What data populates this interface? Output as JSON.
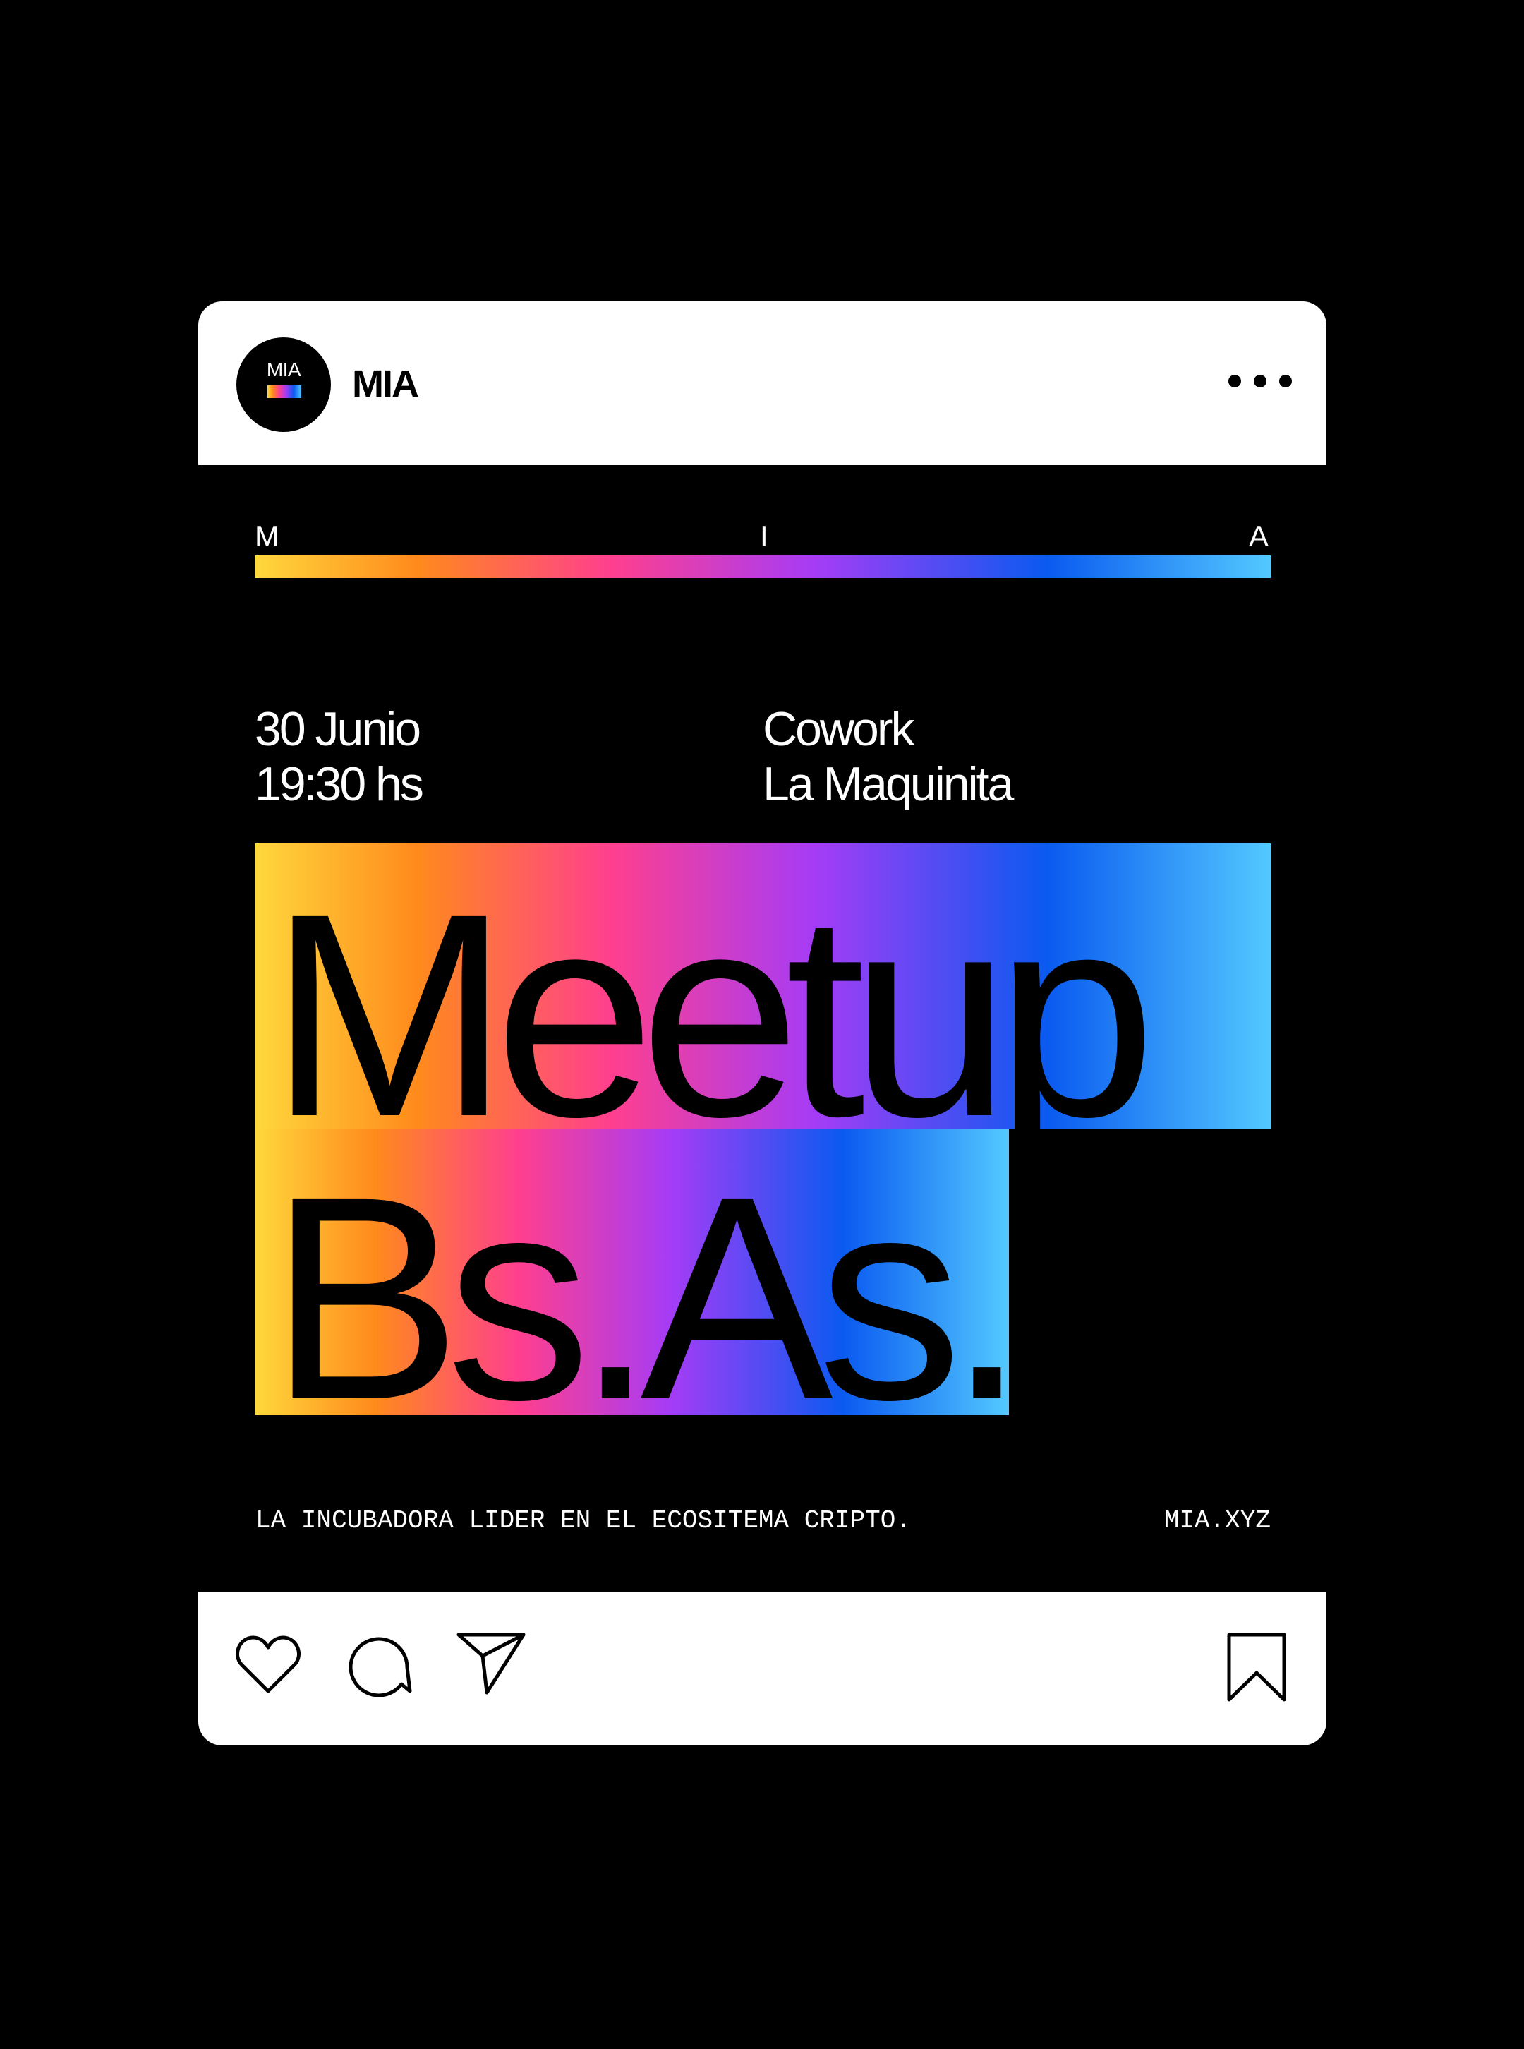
{
  "post": {
    "account_name": "MIA",
    "avatar_text": "MIA",
    "more_icon": "more-horizontal-icon",
    "brand_letters": [
      "M",
      "I",
      "A"
    ],
    "date": "30 Junio",
    "time": "19:30 hs",
    "venue_line1": "Cowork",
    "venue_line2": "La Maquinita",
    "title_line1": "Meetup",
    "title_line2": "Bs.As.",
    "tagline": "LA INCUBADORA LIDER EN EL ECOSITEMA CRIPTO.",
    "domain": "MIA.XYZ",
    "actions": {
      "like_icon": "heart-icon",
      "comment_icon": "comment-icon",
      "share_icon": "send-icon",
      "save_icon": "bookmark-icon"
    }
  },
  "colors": {
    "background": "#000000",
    "card": "#ffffff",
    "gradient": [
      "#ffd83c",
      "#ff8a1c",
      "#ff3f8e",
      "#a63cf6",
      "#0a5af0",
      "#53c9ff"
    ]
  }
}
